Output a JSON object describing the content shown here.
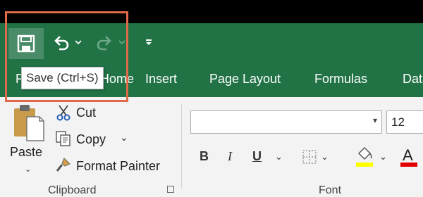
{
  "quick_access": {
    "save_tooltip": "Save (Ctrl+S)"
  },
  "tabs": [
    "File",
    "Home",
    "Insert",
    "Page Layout",
    "Formulas",
    "Data"
  ],
  "clipboard": {
    "paste_label": "Paste",
    "cut_label": "Cut",
    "copy_label": "Copy",
    "format_painter_label": "Format Painter",
    "group_label": "Clipboard"
  },
  "font": {
    "font_name": "",
    "font_size": "12",
    "group_label": "Font",
    "bold": "B",
    "italic": "I",
    "underline": "U",
    "font_color": "A"
  },
  "colors": {
    "ribbon_green": "#217346",
    "highlight_box": "#e06a4a",
    "highlight_yellow": "#ffff00",
    "font_red": "#e00000"
  }
}
